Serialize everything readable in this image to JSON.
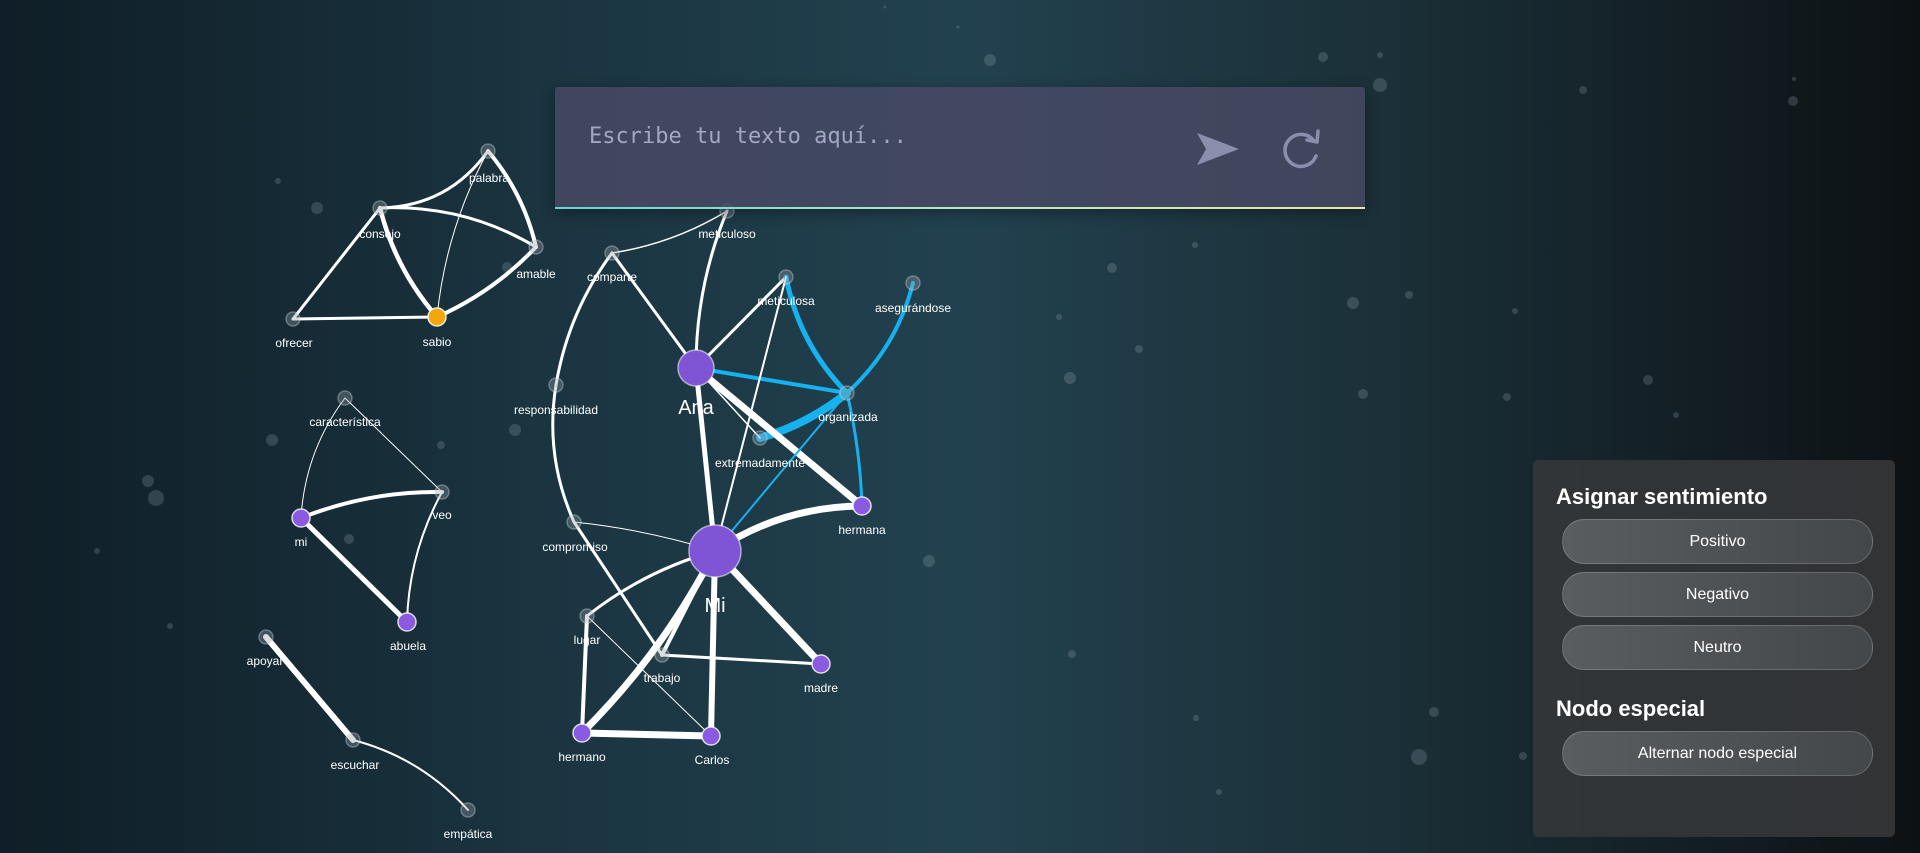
{
  "input": {
    "placeholder": "Escribe tu texto aquí..."
  },
  "panel": {
    "sentiment_title": "Asignar sentimiento",
    "positive_label": "Positivo",
    "negative_label": "Negativo",
    "neutral_label": "Neutro",
    "special_title": "Nodo especial",
    "toggle_special_label": "Alternar nodo especial"
  },
  "colors": {
    "edge": "#ffffff",
    "edge_highlight": "#17b1f0",
    "node_hub": "#7f55d6",
    "node_leaf": "#8a5ae0",
    "node_special": "#f2a80c",
    "node_neutral": "#9aa5ab"
  },
  "graph": {
    "nodes": [
      {
        "id": "palabra",
        "label": "palabra",
        "kind": "neutral"
      },
      {
        "id": "consejo",
        "label": "consejo",
        "kind": "neutral"
      },
      {
        "id": "amable",
        "label": "amable",
        "kind": "neutral"
      },
      {
        "id": "ofrecer",
        "label": "ofrecer",
        "kind": "neutral"
      },
      {
        "id": "sabio",
        "label": "sabio",
        "kind": "special"
      },
      {
        "id": "caracteristica",
        "label": "característica",
        "kind": "neutral"
      },
      {
        "id": "veo",
        "label": "veo",
        "kind": "neutral"
      },
      {
        "id": "mi",
        "label": "mi",
        "kind": "leaf"
      },
      {
        "id": "abuela",
        "label": "abuela",
        "kind": "leaf"
      },
      {
        "id": "apoyar",
        "label": "apoyar",
        "kind": "neutral"
      },
      {
        "id": "escuchar",
        "label": "escuchar",
        "kind": "neutral"
      },
      {
        "id": "empatica",
        "label": "empática",
        "kind": "neutral"
      },
      {
        "id": "meticuloso",
        "label": "meticuloso",
        "kind": "neutral"
      },
      {
        "id": "comparte",
        "label": "comparte",
        "kind": "neutral"
      },
      {
        "id": "meticulosa",
        "label": "meticulosa",
        "kind": "neutral"
      },
      {
        "id": "asegurandose",
        "label": "asegurándose",
        "kind": "neutral"
      },
      {
        "id": "ana",
        "label": "Ana",
        "kind": "hub"
      },
      {
        "id": "responsabilidad",
        "label": "responsabilidad",
        "kind": "neutral"
      },
      {
        "id": "organizada",
        "label": "organizada",
        "kind": "neutral"
      },
      {
        "id": "extremadamente",
        "label": "extremadamente",
        "kind": "neutral"
      },
      {
        "id": "hermana",
        "label": "hermana",
        "kind": "leaf"
      },
      {
        "id": "compromiso",
        "label": "compromiso",
        "kind": "neutral"
      },
      {
        "id": "Mi",
        "label": "Mi",
        "kind": "hub"
      },
      {
        "id": "lugar",
        "label": "lugar",
        "kind": "neutral"
      },
      {
        "id": "trabajo",
        "label": "trabajo",
        "kind": "neutral"
      },
      {
        "id": "madre",
        "label": "madre",
        "kind": "leaf"
      },
      {
        "id": "hermano",
        "label": "hermano",
        "kind": "leaf"
      },
      {
        "id": "carlos",
        "label": "Carlos",
        "kind": "leaf"
      }
    ],
    "edges": [
      [
        "consejo",
        "palabra"
      ],
      [
        "palabra",
        "amable"
      ],
      [
        "palabra",
        "sabio"
      ],
      [
        "consejo",
        "amable"
      ],
      [
        "consejo",
        "sabio"
      ],
      [
        "consejo",
        "ofrecer"
      ],
      [
        "ofrecer",
        "sabio"
      ],
      [
        "sabio",
        "amable"
      ],
      [
        "caracteristica",
        "mi"
      ],
      [
        "caracteristica",
        "veo"
      ],
      [
        "mi",
        "veo"
      ],
      [
        "mi",
        "abuela"
      ],
      [
        "veo",
        "abuela"
      ],
      [
        "apoyar",
        "escuchar"
      ],
      [
        "escuchar",
        "empatica"
      ],
      [
        "meticuloso",
        "comparte"
      ],
      [
        "meticuloso",
        "ana"
      ],
      [
        "comparte",
        "ana"
      ],
      [
        "comparte",
        "responsabilidad"
      ],
      [
        "ana",
        "meticulosa"
      ],
      [
        "ana",
        "organizada"
      ],
      [
        "meticulosa",
        "organizada"
      ],
      [
        "asegurandose",
        "organizada"
      ],
      [
        "organizada",
        "extremadamente"
      ],
      [
        "organizada",
        "hermana"
      ],
      [
        "ana",
        "hermana"
      ],
      [
        "ana",
        "extremadamente"
      ],
      [
        "ana",
        "Mi"
      ],
      [
        "meticulosa",
        "Mi"
      ],
      [
        "Mi",
        "organizada"
      ],
      [
        "Mi",
        "hermana"
      ],
      [
        "responsabilidad",
        "compromiso"
      ],
      [
        "compromiso",
        "Mi"
      ],
      [
        "compromiso",
        "trabajo"
      ],
      [
        "Mi",
        "trabajo"
      ],
      [
        "Mi",
        "madre"
      ],
      [
        "Mi",
        "hermano"
      ],
      [
        "Mi",
        "carlos"
      ],
      [
        "lugar",
        "hermano"
      ],
      [
        "lugar",
        "Mi"
      ],
      [
        "lugar",
        "carlos"
      ],
      [
        "hermano",
        "carlos"
      ],
      [
        "trabajo",
        "madre"
      ],
      [
        "ana",
        "extremadamente"
      ]
    ]
  }
}
